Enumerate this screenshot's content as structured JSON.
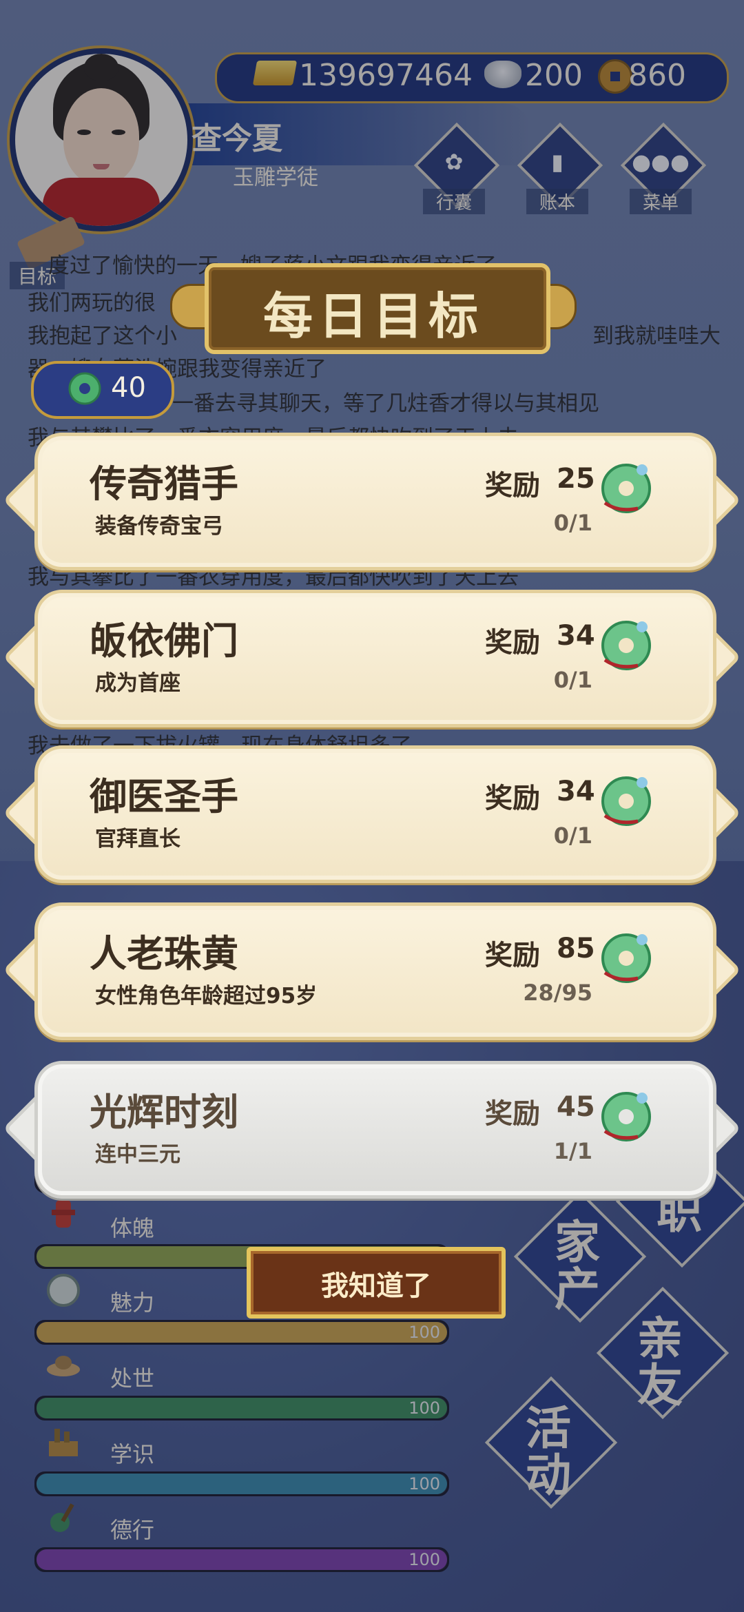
{
  "player": {
    "name": "查今夏",
    "title": "玉雕学徒"
  },
  "currency": {
    "gold": "139697464",
    "silver": "200",
    "coin": "860"
  },
  "top_menu": [
    {
      "label": "行囊",
      "icon": "bag-icon"
    },
    {
      "label": "账本",
      "icon": "ledger-icon"
    },
    {
      "label": "菜单",
      "icon": "menu-dots-icon"
    }
  ],
  "target_label": "目标",
  "log_lines": [
    "度过了愉快的一天，嫂子蒋小文跟我变得亲近了",
    "我们两玩的很",
    "我抱起了这个小",
    "到我就哇哇大",
    "器。嫂女蒋浩婉跟我变得亲近了",
    "一番去寻其聊天，等了几炷香才得以与其相见",
    "我与其攀比了一番衣穿用度，最后都快吹到了天上去",
    "我与其攀比了一番衣穿用度，最后都快吹到了天上去",
    "我去做了一下拔火罐，现在身体舒坦多了"
  ],
  "dialog": {
    "title": "每日目标",
    "points": "40",
    "reward_label": "奖励",
    "confirm_label": "我知道了",
    "tasks": [
      {
        "title": "传奇猎手",
        "desc": "装备传奇宝弓",
        "reward": "25",
        "progress": "0/1"
      },
      {
        "title": "皈依佛门",
        "desc": "成为首座",
        "reward": "34",
        "progress": "0/1"
      },
      {
        "title": "御医圣手",
        "desc": "官拜直长",
        "reward": "34",
        "progress": "0/1"
      },
      {
        "title": "人老珠黄",
        "desc": "女性角色年龄超过95岁",
        "reward": "85",
        "progress": "28/95"
      },
      {
        "title": "光辉时刻",
        "desc": "连中三元",
        "reward": "45",
        "progress": "1/1"
      }
    ]
  },
  "stats": [
    {
      "label": "体魄",
      "value": "",
      "color": "#8fa34a"
    },
    {
      "label": "魅力",
      "value": "100",
      "color": "#c9a249"
    },
    {
      "label": "处世",
      "value": "100",
      "color": "#3c8a5a"
    },
    {
      "label": "学识",
      "value": "100",
      "color": "#3a87a6"
    },
    {
      "label": "德行",
      "value": "100",
      "color": "#7c3fa6"
    }
  ],
  "side_buttons": [
    {
      "line1": "家",
      "line2": "产"
    },
    {
      "line1": "亲",
      "line2": "友"
    },
    {
      "line1": "活",
      "line2": "动"
    },
    {
      "line1": "职",
      "line2": ""
    }
  ]
}
